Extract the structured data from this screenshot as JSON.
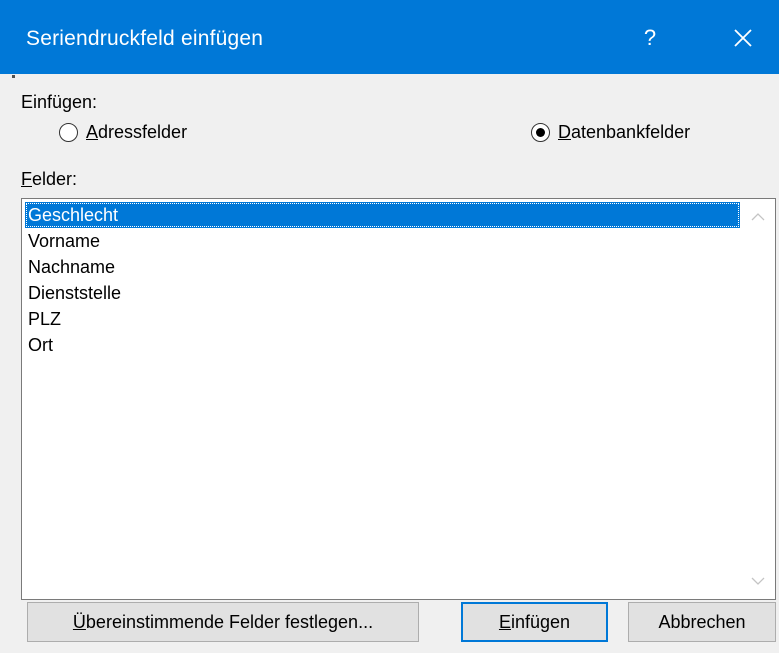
{
  "window": {
    "title": "Seriendruckfeld einfügen",
    "help_label": "?"
  },
  "insert_group": {
    "label": "Einfügen:",
    "options": [
      {
        "access_key": "A",
        "rest": "dressfelder",
        "selected": false
      },
      {
        "access_key": "D",
        "rest": "atenbankfelder",
        "selected": true
      }
    ]
  },
  "fields": {
    "label_key": "F",
    "label_rest": "elder:",
    "items": [
      "Geschlecht",
      "Vorname",
      "Nachname",
      "Dienststelle",
      "PLZ",
      "Ort"
    ],
    "selected_index": 0
  },
  "buttons": {
    "match": {
      "access_key": "Ü",
      "rest": "bereinstimmende Felder festlegen..."
    },
    "insert": {
      "access_key": "E",
      "rest": "infügen"
    },
    "cancel": {
      "label": "Abbrechen"
    }
  },
  "colors": {
    "titlebar": "#0078d7",
    "selection": "#0078d7",
    "dialog_background": "#f0f0f0"
  }
}
